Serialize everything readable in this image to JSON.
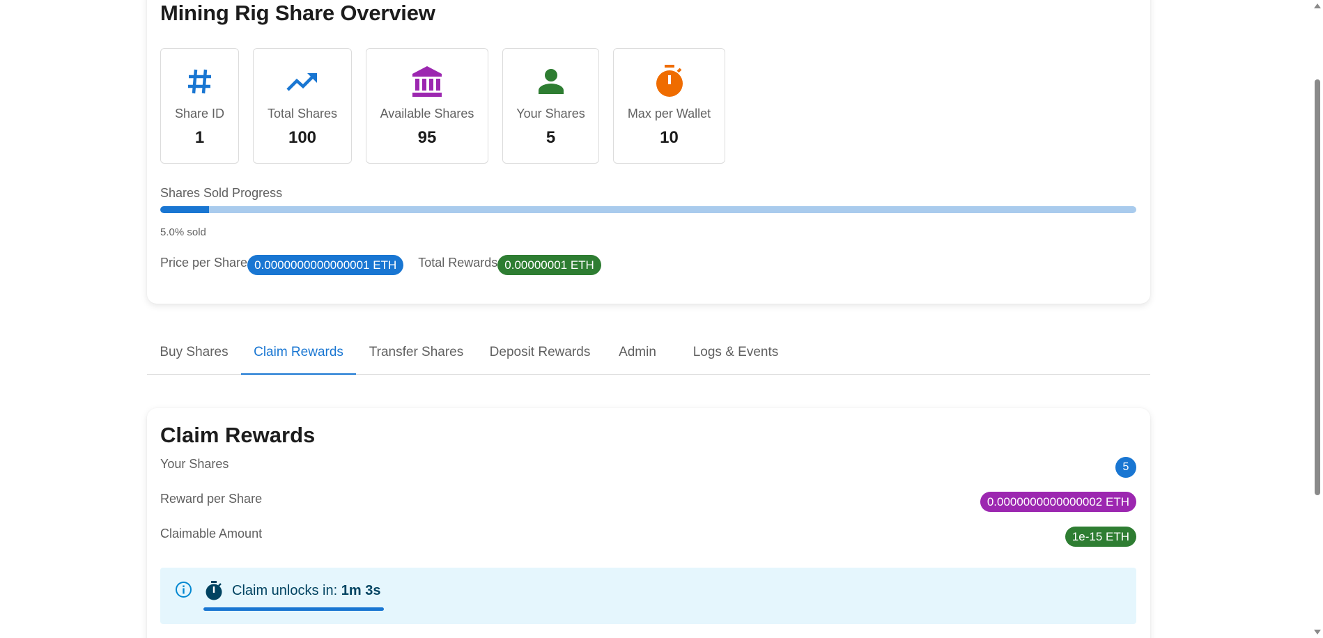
{
  "overview": {
    "title": "Mining Rig Share Overview",
    "stats": [
      {
        "label": "Share ID",
        "value": "1",
        "icon": "hash-icon",
        "color": "#1976d2"
      },
      {
        "label": "Total Shares",
        "value": "100",
        "icon": "trending-up-icon",
        "color": "#1976d2"
      },
      {
        "label": "Available Shares",
        "value": "95",
        "icon": "bank-icon",
        "color": "#9c27b0"
      },
      {
        "label": "Your Shares",
        "value": "5",
        "icon": "person-icon",
        "color": "#2e7d32"
      },
      {
        "label": "Max per Wallet",
        "value": "10",
        "icon": "timer-icon",
        "color": "#ef6c00"
      }
    ],
    "progress_label": "Shares Sold Progress",
    "progress_fraction": 0.05,
    "progress_text": "5.0% sold",
    "price_label": "Price per Share",
    "price_value": "0.0000000000000001 ETH",
    "rewards_label": "Total Rewards",
    "rewards_value": "0.00000001 ETH"
  },
  "tabs": [
    {
      "label": "Buy Shares",
      "active": false
    },
    {
      "label": "Claim Rewards",
      "active": true
    },
    {
      "label": "Transfer Shares",
      "active": false
    },
    {
      "label": "Deposit Rewards",
      "active": false
    },
    {
      "label": "Admin",
      "active": false
    },
    {
      "label": "Logs & Events",
      "active": false
    }
  ],
  "claim": {
    "title": "Claim Rewards",
    "your_shares_label": "Your Shares",
    "your_shares_value": "5",
    "reward_per_share_label": "Reward per Share",
    "reward_per_share_value": "0.0000000000000002 ETH",
    "claimable_label": "Claimable Amount",
    "claimable_value": "1e-15 ETH",
    "unlock_label": "Claim unlocks in:",
    "unlock_time": "1m 3s"
  },
  "colors": {
    "primary": "#1976d2",
    "success": "#2e7d32",
    "secondary": "#9c27b0",
    "warning": "#ef6c00",
    "info_bg": "#e5f6fd"
  }
}
